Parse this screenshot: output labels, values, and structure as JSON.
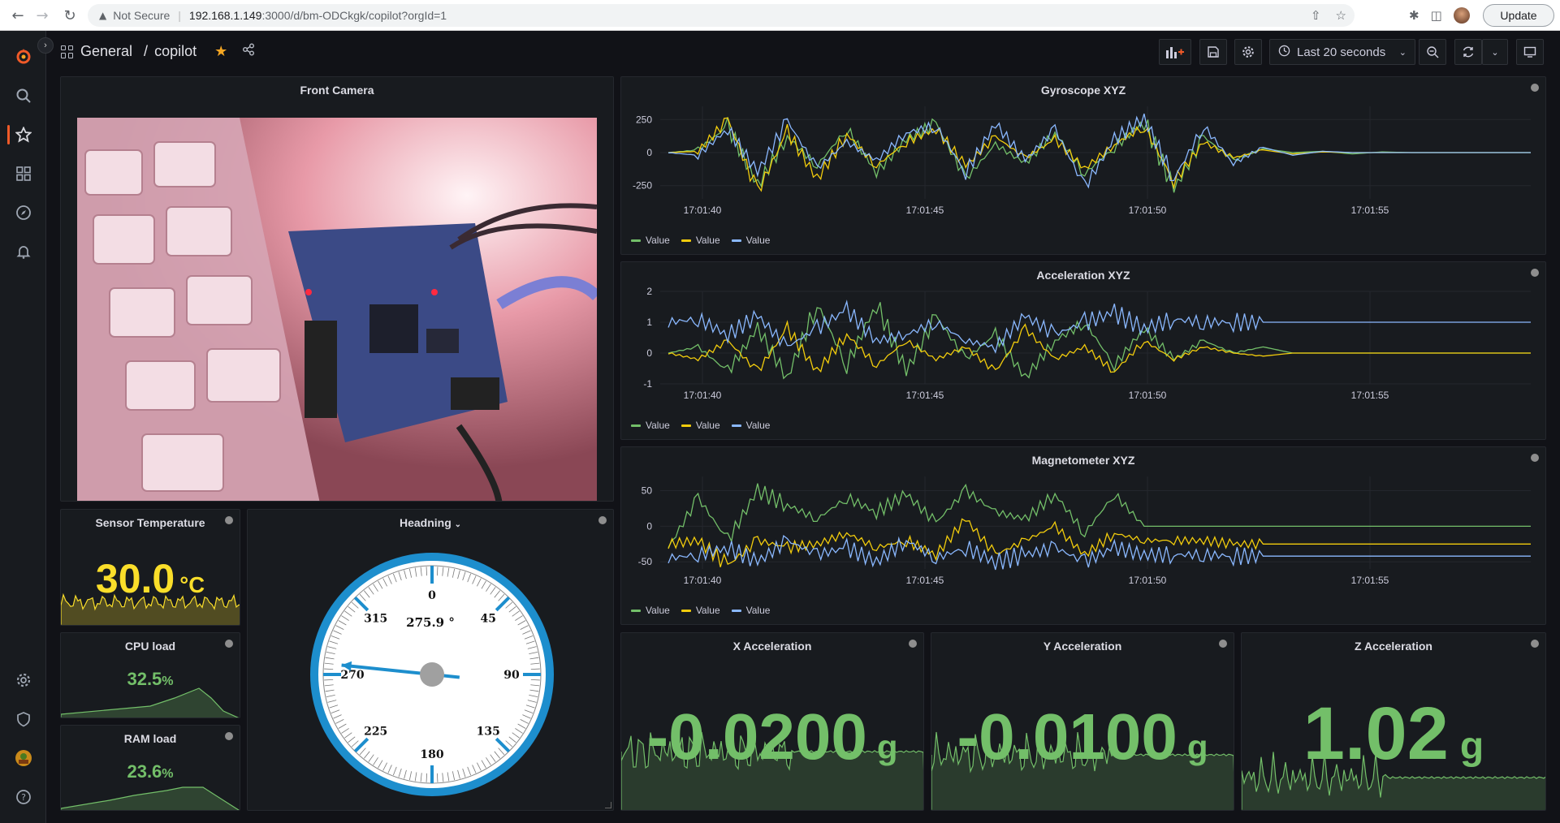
{
  "browser": {
    "warning": "Not Secure",
    "url_host": "192.168.1.149",
    "url_path": ":3000/d/bm-ODCkgk/copilot?orgId=1",
    "update_label": "Update"
  },
  "sidebar": {
    "items": [
      {
        "icon": "grafana-logo-icon"
      },
      {
        "icon": "search-icon"
      },
      {
        "icon": "star-icon"
      },
      {
        "icon": "dashboards-icon"
      },
      {
        "icon": "explore-icon"
      },
      {
        "icon": "alerting-bell-icon"
      },
      {
        "icon": "gear-icon"
      },
      {
        "icon": "shield-icon"
      },
      {
        "icon": "user-avatar-icon"
      },
      {
        "icon": "help-icon"
      }
    ]
  },
  "topnav": {
    "folder": "General",
    "separator": "/",
    "dashboard": "copilot",
    "time_range": "Last 20 seconds"
  },
  "colors": {
    "green": "#73bf69",
    "yellow": "#f2cc0c",
    "blue": "#8ab8ff",
    "gauge_rim": "#1d8ecd",
    "accent": "#f05a28",
    "temp_yellow": "#fade2a"
  },
  "panels": {
    "camera": {
      "title": "Front Camera"
    },
    "gyro": {
      "title": "Gyroscope XYZ"
    },
    "accel": {
      "title": "Acceleration XYZ"
    },
    "mag": {
      "title": "Magnetometer XYZ"
    },
    "temperature": {
      "title": "Sensor Temperature",
      "value": "30.0",
      "unit": "°C"
    },
    "heading": {
      "title": "Headning",
      "value": "275.9 °",
      "heading_deg": 275.9
    },
    "cpu": {
      "title": "CPU load",
      "value": "32.5",
      "unit": "%"
    },
    "ram": {
      "title": "RAM load",
      "value": "23.6",
      "unit": "%"
    },
    "x_accel": {
      "title": "X Acceleration",
      "value": "-0.0200",
      "unit": "g"
    },
    "y_accel": {
      "title": "Y Acceleration",
      "value": "-0.0100",
      "unit": "g"
    },
    "z_accel": {
      "title": "Z Acceleration",
      "value": "1.02",
      "unit": "g"
    }
  },
  "gauge": {
    "labels": [
      "0",
      "45",
      "90",
      "135",
      "180",
      "225",
      "270",
      "315"
    ]
  },
  "chart_data": [
    {
      "type": "line",
      "title": "Gyroscope XYZ",
      "x_ticks": [
        "17:01:40",
        "17:01:45",
        "17:01:50",
        "17:01:55"
      ],
      "y_ticks": [
        250,
        0,
        -250
      ],
      "ylim": [
        -350,
        350
      ],
      "series": [
        {
          "name": "Value",
          "color": "#73bf69",
          "values": [
            0,
            20,
            200,
            -250,
            120,
            -100,
            180,
            -150,
            100,
            220,
            -200,
            60,
            -80,
            150,
            -160,
            40,
            240,
            -280,
            120,
            -60,
            30,
            0,
            10,
            -10,
            5,
            0,
            0,
            0,
            0,
            0
          ]
        },
        {
          "name": "Value",
          "color": "#f2cc0c",
          "values": [
            0,
            10,
            250,
            -300,
            160,
            -200,
            140,
            -100,
            80,
            180,
            -100,
            120,
            -40,
            100,
            -120,
            60,
            200,
            -220,
            80,
            -40,
            20,
            -10,
            5,
            0,
            0,
            0,
            0,
            0,
            0,
            0
          ]
        },
        {
          "name": "Value",
          "color": "#8ab8ff",
          "values": [
            0,
            -20,
            180,
            -150,
            240,
            -120,
            80,
            -60,
            150,
            200,
            -150,
            220,
            -60,
            180,
            -260,
            100,
            260,
            -200,
            200,
            -80,
            40,
            -20,
            10,
            0,
            0,
            0,
            0,
            0,
            0,
            0
          ]
        }
      ]
    },
    {
      "type": "line",
      "title": "Acceleration XYZ",
      "x_ticks": [
        "17:01:40",
        "17:01:45",
        "17:01:50",
        "17:01:55"
      ],
      "y_ticks": [
        2,
        1,
        0,
        -1
      ],
      "ylim": [
        -1,
        2
      ],
      "series": [
        {
          "name": "Value",
          "color": "#73bf69",
          "values": [
            0,
            0.2,
            -0.6,
            0.8,
            -0.8,
            1.6,
            -0.4,
            1.6,
            -0.6,
            1.2,
            -0.2,
            0.6,
            -0.8,
            0.4,
            1.0,
            -0.4,
            0.8,
            -0.2,
            0.4,
            0,
            0.2,
            0,
            0,
            0,
            0,
            0,
            0,
            0,
            0,
            0
          ]
        },
        {
          "name": "Value",
          "color": "#f2cc0c",
          "values": [
            0,
            -0.2,
            0.4,
            -0.6,
            0.8,
            -0.6,
            0.6,
            -0.4,
            0.4,
            -0.2,
            0.2,
            -0.6,
            0.8,
            -0.2,
            0.2,
            -0.6,
            0.4,
            -0.2,
            0.2,
            0,
            -0.1,
            0,
            0,
            0,
            0,
            0,
            0,
            0,
            0,
            0
          ]
        },
        {
          "name": "Value",
          "color": "#8ab8ff",
          "values": [
            1,
            1.1,
            0.6,
            1.2,
            0.2,
            0.8,
            1.4,
            0.4,
            0.6,
            1.0,
            0.4,
            0.2,
            1.2,
            0.6,
            1.0,
            1.3,
            0.8,
            1.1,
            1.0,
            1.0,
            1.0,
            1.0,
            1.0,
            1.0,
            1.0,
            1.0,
            1.0,
            1.0,
            1.0,
            1.0
          ]
        }
      ]
    },
    {
      "type": "line",
      "title": "Magnetometer XYZ",
      "x_ticks": [
        "17:01:40",
        "17:01:45",
        "17:01:50",
        "17:01:55"
      ],
      "y_ticks": [
        50,
        0,
        -50
      ],
      "ylim": [
        -60,
        70
      ],
      "series": [
        {
          "name": "Value",
          "color": "#73bf69",
          "values": [
            -30,
            40,
            -20,
            50,
            30,
            10,
            40,
            20,
            45,
            5,
            50,
            20,
            10,
            45,
            -10,
            45,
            0,
            0,
            0,
            0,
            0,
            0,
            0,
            0,
            0,
            0,
            0,
            0,
            0,
            0
          ]
        },
        {
          "name": "Value",
          "color": "#f2cc0c",
          "values": [
            -25,
            -20,
            -55,
            -20,
            -30,
            -25,
            -10,
            -30,
            -20,
            -40,
            10,
            -40,
            -20,
            0,
            -40,
            -10,
            -20,
            -20,
            -20,
            -25,
            -25,
            -25,
            -25,
            -25,
            -25,
            -25,
            -25,
            -25,
            -25,
            -25
          ]
        },
        {
          "name": "Value",
          "color": "#8ab8ff",
          "values": [
            -45,
            -40,
            -30,
            -50,
            -20,
            -40,
            -30,
            -50,
            -20,
            -45,
            -30,
            -50,
            -40,
            -30,
            -50,
            -30,
            -40,
            -40,
            -40,
            -42,
            -42,
            -42,
            -42,
            -42,
            -42,
            -42,
            -42,
            -42,
            -42,
            -42
          ]
        }
      ]
    }
  ]
}
